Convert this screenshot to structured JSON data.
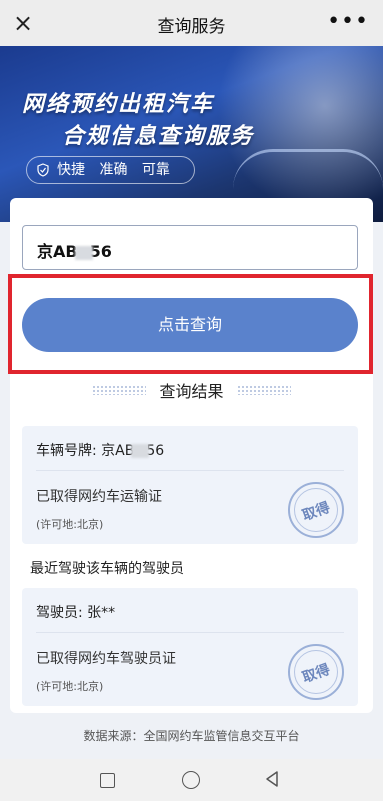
{
  "header": {
    "title": "查询服务",
    "close_icon": "×",
    "more_icon": "•••"
  },
  "banner": {
    "line1": "网络预约出租汽车",
    "line2": "合规信息查询服务",
    "tags": [
      "快捷",
      "准确",
      "可靠"
    ]
  },
  "search": {
    "value_prefix": "京AB",
    "value_suffix": "56"
  },
  "query_button": {
    "label": "点击查询"
  },
  "result": {
    "title": "查询结果"
  },
  "vehicle": {
    "plate_label": "车辆号牌: 京AB",
    "plate_suffix": "56",
    "license_status": "已取得网约车运输证",
    "permit_place": "(许可地:北京)",
    "stamp": "取得"
  },
  "recent_drivers_label": "最近驾驶该车辆的驾驶员",
  "driver": {
    "name": "驾驶员: 张**",
    "license_status": "已取得网约车驾驶员证",
    "permit_place": "(许可地:北京)",
    "stamp": "取得"
  },
  "source": "数据来源：全国网约车监管信息交互平台",
  "colors": {
    "accent": "#5a82cc",
    "highlight_box": "#e0252e"
  }
}
